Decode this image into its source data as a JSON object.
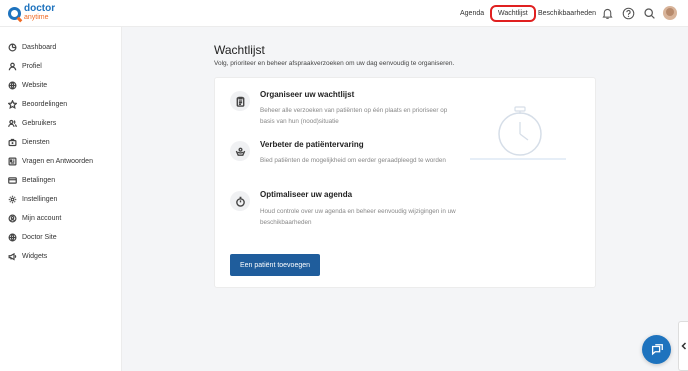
{
  "brand": {
    "line1": "doctor",
    "line2": "anytime",
    "primary_color": "#1e73be",
    "accent_color": "#f06a24"
  },
  "topnav": {
    "agenda": "Agenda",
    "wachtlijst": "Wachtlijst",
    "beschikbaarheden": "Beschikbaarheden",
    "icons": [
      "bell-icon",
      "help-icon",
      "search-icon"
    ]
  },
  "sidebar": {
    "items": [
      {
        "label": "Dashboard",
        "icon": "dashboard-icon"
      },
      {
        "label": "Profiel",
        "icon": "user-icon"
      },
      {
        "label": "Website",
        "icon": "globe-icon"
      },
      {
        "label": "Beoordelingen",
        "icon": "star-icon"
      },
      {
        "label": "Gebruikers",
        "icon": "users-icon"
      },
      {
        "label": "Diensten",
        "icon": "briefcase-icon"
      },
      {
        "label": "Vragen en Antwoorden",
        "icon": "qa-icon"
      },
      {
        "label": "Betalingen",
        "icon": "card-icon"
      },
      {
        "label": "Instellingen",
        "icon": "gear-icon"
      },
      {
        "label": "Mijn account",
        "icon": "account-icon"
      },
      {
        "label": "Doctor Site",
        "icon": "globe-icon"
      },
      {
        "label": "Widgets",
        "icon": "megaphone-icon"
      }
    ]
  },
  "main": {
    "title": "Wachtlijst",
    "subtitle": "Volg, prioriteer en beheer afspraakverzoeken om uw dag eenvoudig te organiseren.",
    "features": [
      {
        "title": "Organiseer uw wachtlijst",
        "desc": "Beheer alle verzoeken van patiënten op één plaats en prioriseer op basis van hun (nood)situatie",
        "icon": "clipboard-icon"
      },
      {
        "title": "Verbeter de patiëntervaring",
        "desc": "Bied patiënten de mogelijkheid om eerder geraadpleegd te worden",
        "icon": "care-icon"
      },
      {
        "title": "Optimaliseer uw agenda",
        "desc": "Houd controle over uw agenda en beheer eenvoudig wijzigingen in uw beschikbaarheden",
        "icon": "stopwatch-icon"
      }
    ],
    "button": "Een patiënt toevoegen"
  }
}
